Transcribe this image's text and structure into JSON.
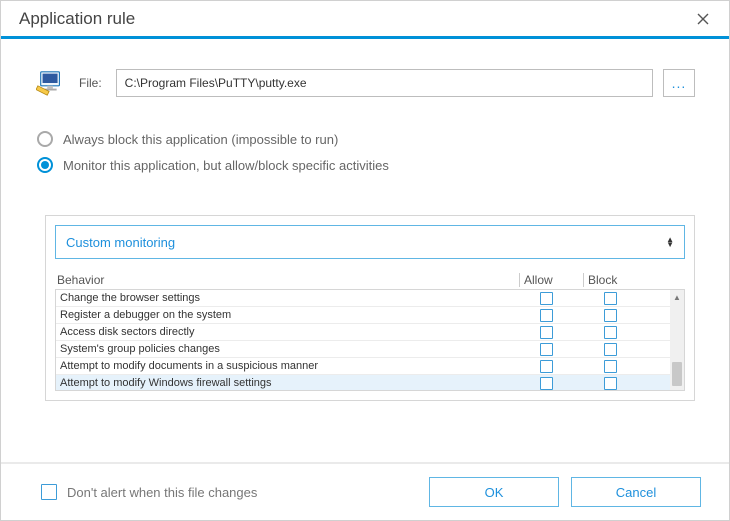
{
  "title": "Application rule",
  "file": {
    "label": "File:",
    "path": "C:\\Program Files\\PuTTY\\putty.exe",
    "browse_label": "..."
  },
  "radio": {
    "options": [
      {
        "label": "Always block this application (impossible to run)",
        "selected": false
      },
      {
        "label": "Monitor this application, but allow/block specific activities",
        "selected": true
      }
    ]
  },
  "monitor": {
    "dropdown_label": "Custom monitoring",
    "columns": {
      "behavior": "Behavior",
      "allow": "Allow",
      "block": "Block"
    },
    "behaviors": [
      {
        "label": "Change the browser settings",
        "allow": false,
        "block": false,
        "highlight": false
      },
      {
        "label": "Register a debugger on the system",
        "allow": false,
        "block": false,
        "highlight": false
      },
      {
        "label": "Access disk sectors directly",
        "allow": false,
        "block": false,
        "highlight": false
      },
      {
        "label": "System's group policies changes",
        "allow": false,
        "block": false,
        "highlight": false
      },
      {
        "label": "Attempt to modify documents in a suspicious manner",
        "allow": false,
        "block": false,
        "highlight": false
      },
      {
        "label": "Attempt to modify Windows firewall settings",
        "allow": false,
        "block": false,
        "highlight": true
      }
    ]
  },
  "footer": {
    "alert_label": "Don't alert when this file changes",
    "ok": "OK",
    "cancel": "Cancel"
  }
}
